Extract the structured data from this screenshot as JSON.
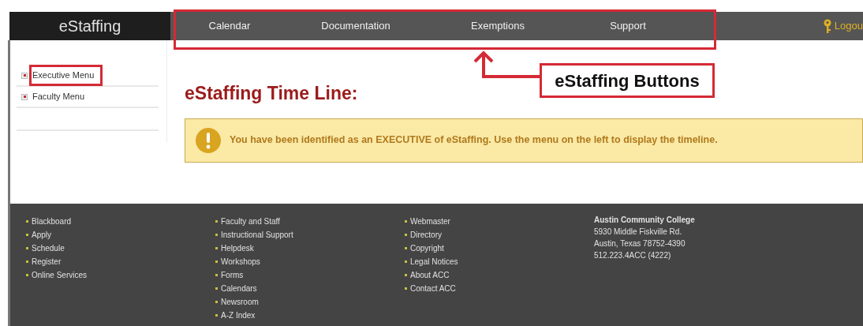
{
  "header": {
    "logo": "eStaffing",
    "nav": [
      {
        "label": "Calendar"
      },
      {
        "label": "Documentation"
      },
      {
        "label": "Exemptions"
      },
      {
        "label": "Support"
      }
    ],
    "logout": "Logou"
  },
  "sidebar": {
    "items": [
      {
        "label": "Executive Menu",
        "highlighted": true
      },
      {
        "label": "Faculty Menu",
        "highlighted": false
      }
    ]
  },
  "main": {
    "title": "eStaffing Time Line:",
    "notice": "You have been identified as an EXECUTIVE of eStaffing. Use the menu on the left to display the timeline."
  },
  "annotation": {
    "label": "eStaffing Buttons"
  },
  "footer": {
    "columns": [
      [
        "Blackboard",
        "Apply",
        "Schedule",
        "Register",
        "Online Services"
      ],
      [
        "Faculty and Staff",
        "Instructional Support",
        "Helpdesk",
        "Workshops",
        "Forms",
        "Calendars",
        "Newsroom",
        "A-Z Index"
      ],
      [
        "Webmaster",
        "Directory",
        "Copyright",
        "Legal Notices",
        "About ACC",
        "Contact ACC"
      ]
    ],
    "address": [
      "Austin Community College",
      "5930 Middle Fiskville Rd.",
      "Austin, Texas 78752-4390",
      "512.223.4ACC (4222)"
    ]
  }
}
